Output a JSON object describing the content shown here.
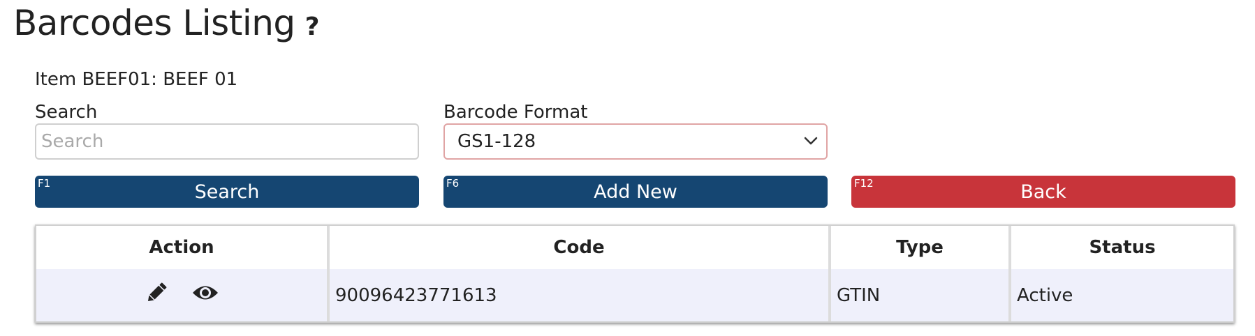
{
  "page": {
    "title": "Barcodes Listing",
    "help_icon": "?",
    "item_label": "Item BEEF01: BEEF 01"
  },
  "search": {
    "label": "Search",
    "placeholder": "Search",
    "value": ""
  },
  "barcode_format": {
    "label": "Barcode Format",
    "selected": "GS1-128"
  },
  "buttons": {
    "search": {
      "fkey": "F1",
      "label": "Search"
    },
    "add_new": {
      "fkey": "F6",
      "label": "Add New"
    },
    "back": {
      "fkey": "F12",
      "label": "Back"
    }
  },
  "colors": {
    "primary_button": "#154672",
    "danger_button": "#c8343a",
    "row_background": "#eff0fb"
  },
  "table": {
    "headers": [
      "Action",
      "Code",
      "Type",
      "Status"
    ],
    "rows": [
      {
        "actions": [
          "pencil-icon",
          "eye-icon"
        ],
        "code": "90096423771613",
        "type": "GTIN",
        "status": "Active"
      }
    ]
  }
}
